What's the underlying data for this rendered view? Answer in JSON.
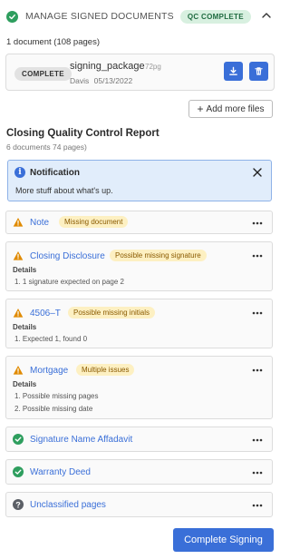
{
  "header": {
    "title": "MANAGE SIGNED DOCUMENTS",
    "status_badge": "QC COMPLETE"
  },
  "summary": "1 document (108 pages)",
  "package": {
    "status": "COMPLETE",
    "name": "signing_package",
    "pages": "72pg",
    "signer": "Davis",
    "date": "05/13/2022"
  },
  "add_more_files": "Add more files",
  "report": {
    "title": "Closing Quality Control Report",
    "subtitle": "6 documents  74 pages)"
  },
  "notification": {
    "title": "Notification",
    "message": "More stuff about what's up."
  },
  "items": [
    {
      "label": "Note",
      "badge": "Missing document"
    },
    {
      "label": "Closing Disclosure",
      "badge": "Possible missing signature",
      "details_label": "Details",
      "details": [
        "1. 1 signature expected on page 2"
      ]
    },
    {
      "label": "4506–T",
      "badge": "Possible missing initials",
      "details_label": "Details",
      "details": [
        "1. Expected 1, found 0"
      ]
    },
    {
      "label": "Mortgage",
      "badge": "Multiple issues",
      "details_label": "Details",
      "details": [
        "1. Possible missing pages",
        "2. Possible missing date"
      ]
    },
    {
      "label": "Signature Name Affadavit"
    },
    {
      "label": "Warranty Deed"
    },
    {
      "label": "Unclassified pages"
    }
  ],
  "complete_button": "Complete Signing",
  "colors": {
    "accent": "#3a6fd8",
    "success": "#2e9e5e",
    "warning": "#e08a00",
    "neutral": "#5b5f66"
  }
}
